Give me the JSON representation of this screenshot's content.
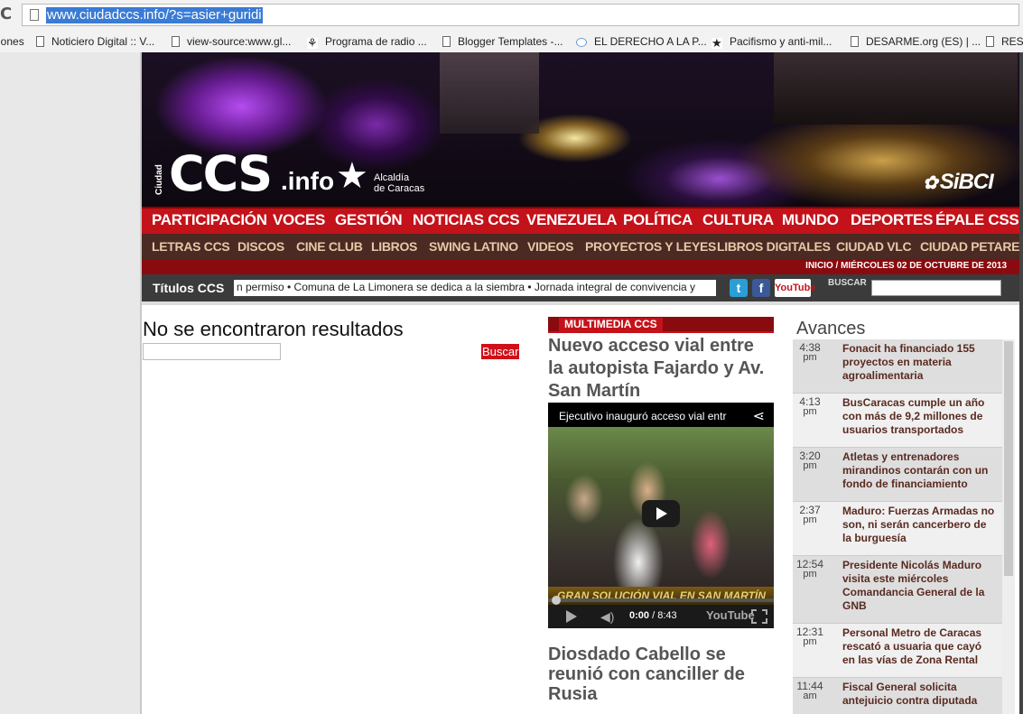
{
  "browser": {
    "url": "www.ciudadccs.info/?s=asier+guridi",
    "bookmarks": [
      "iones",
      "Noticiero Digital :: V...",
      "view-source:www.gl...",
      "Programa de radio ...",
      "Blogger Templates -...",
      "EL DERECHO A LA P...",
      "Pacifismo y anti-mil...",
      "DESARME.org (ES) | ...",
      "RESD"
    ]
  },
  "header": {
    "logo_ciudad": "Ciudad",
    "logo_ccs": "CCS",
    "logo_info": ".info",
    "alcaldia_line1": "Alcaldía",
    "alcaldia_line2": "de Caracas",
    "sibci": "SiBCI"
  },
  "mainnav": [
    "PARTICIPACIÓN",
    "VOCES",
    "GESTIÓN",
    "NOTICIAS CCS",
    "VENEZUELA",
    "POLÍTICA",
    "CULTURA",
    "MUNDO",
    "DEPORTES",
    "ÉPALE CSS"
  ],
  "subnav": [
    "LETRAS CCS",
    "DISCOS",
    "CINE CLUB",
    "LIBROS",
    "SWING LATINO",
    "VIDEOS",
    "PROYECTOS Y LEYES",
    "LIBROS DIGITALES",
    "CIUDAD VLC",
    "CIUDAD PETARE"
  ],
  "dateline": "INICIO / MIÉRCOLES 02 DE OCTUBRE DE 2013",
  "ticker": {
    "label": "Títulos CCS",
    "text": "n permiso  •  Comuna de La Limonera se dedica a la siembra  •  Jornada integral de convivencia y",
    "buscar_label": "BUSCAR",
    "youtube": "YouTube"
  },
  "search": {
    "no_results": "No se encontraron resultados",
    "button": "Buscar"
  },
  "multimedia": {
    "section": "MULTIMEDIA CCS",
    "article1_title": "Nuevo acceso vial entre la autopista Fajardo y Av. San Martín",
    "video_title": "Ejecutivo inauguró acceso vial entr",
    "video_caption": "GRAN SOLUCIÓN VIAL EN SAN MARTÍN",
    "video_current": "0:00",
    "video_total": "/ 8:43",
    "video_brand": "YouTube",
    "article2_title": "Diosdado Cabello se reunió con canciller de Rusia"
  },
  "avances": {
    "title": "Avances",
    "items": [
      {
        "time": "4:38",
        "ampm": "pm",
        "text": "Fonacit ha financiado 155 proyectos en materia agroalimentaria"
      },
      {
        "time": "4:13",
        "ampm": "pm",
        "text": "BusCaracas cumple un año con más de 9,2 millones de usuarios transportados"
      },
      {
        "time": "3:20",
        "ampm": "pm",
        "text": "Atletas y entrenadores mirandinos contarán con un fondo de financiamiento"
      },
      {
        "time": "2:37",
        "ampm": "pm",
        "text": "Maduro: Fuerzas Armadas no son, ni serán cancerbero de la burguesía"
      },
      {
        "time": "12:54",
        "ampm": "pm",
        "text": "Presidente Nicolás Maduro visita este miércoles Comandancia General de la GNB"
      },
      {
        "time": "12:31",
        "ampm": "pm",
        "text": "Personal Metro de Caracas rescató a usuaria que cayó en las vías de Zona Rental"
      },
      {
        "time": "11:44",
        "ampm": "am",
        "text": "Fiscal General solicita antejuicio contra diputada"
      }
    ]
  }
}
